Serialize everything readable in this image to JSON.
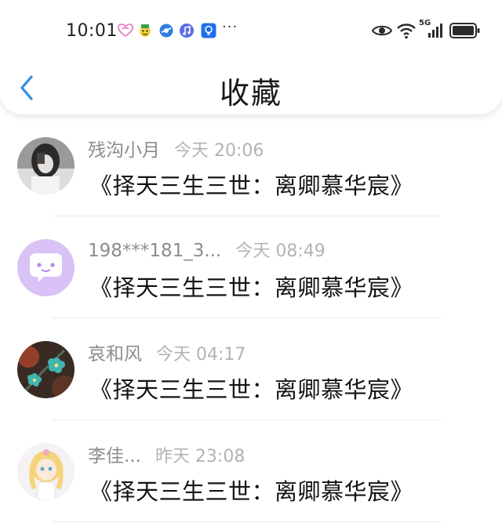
{
  "status_bar": {
    "time": "10:01",
    "notification_icons": [
      "heart-app-icon",
      "emoji-app-icon",
      "browser-app-icon",
      "music-app-icon",
      "bulb-app-icon"
    ],
    "more": "···",
    "network_label": "5G"
  },
  "header": {
    "title": "收藏",
    "back_icon": "chevron-left-icon",
    "accent_color": "#2f8fe0"
  },
  "favorites": [
    {
      "user": "残沟小月",
      "time": "今天 20:06",
      "title": "《择天三生三世：离卿慕华宸》"
    },
    {
      "user": "198***181_3...",
      "time": "今天 08:49",
      "title": "《择天三生三世：离卿慕华宸》"
    },
    {
      "user": "哀和风",
      "time": "今天 04:17",
      "title": "《择天三生三世：离卿慕华宸》"
    },
    {
      "user": "李佳...",
      "time": "昨天 23:08",
      "title": "《择天三生三世：离卿慕华宸》"
    }
  ]
}
